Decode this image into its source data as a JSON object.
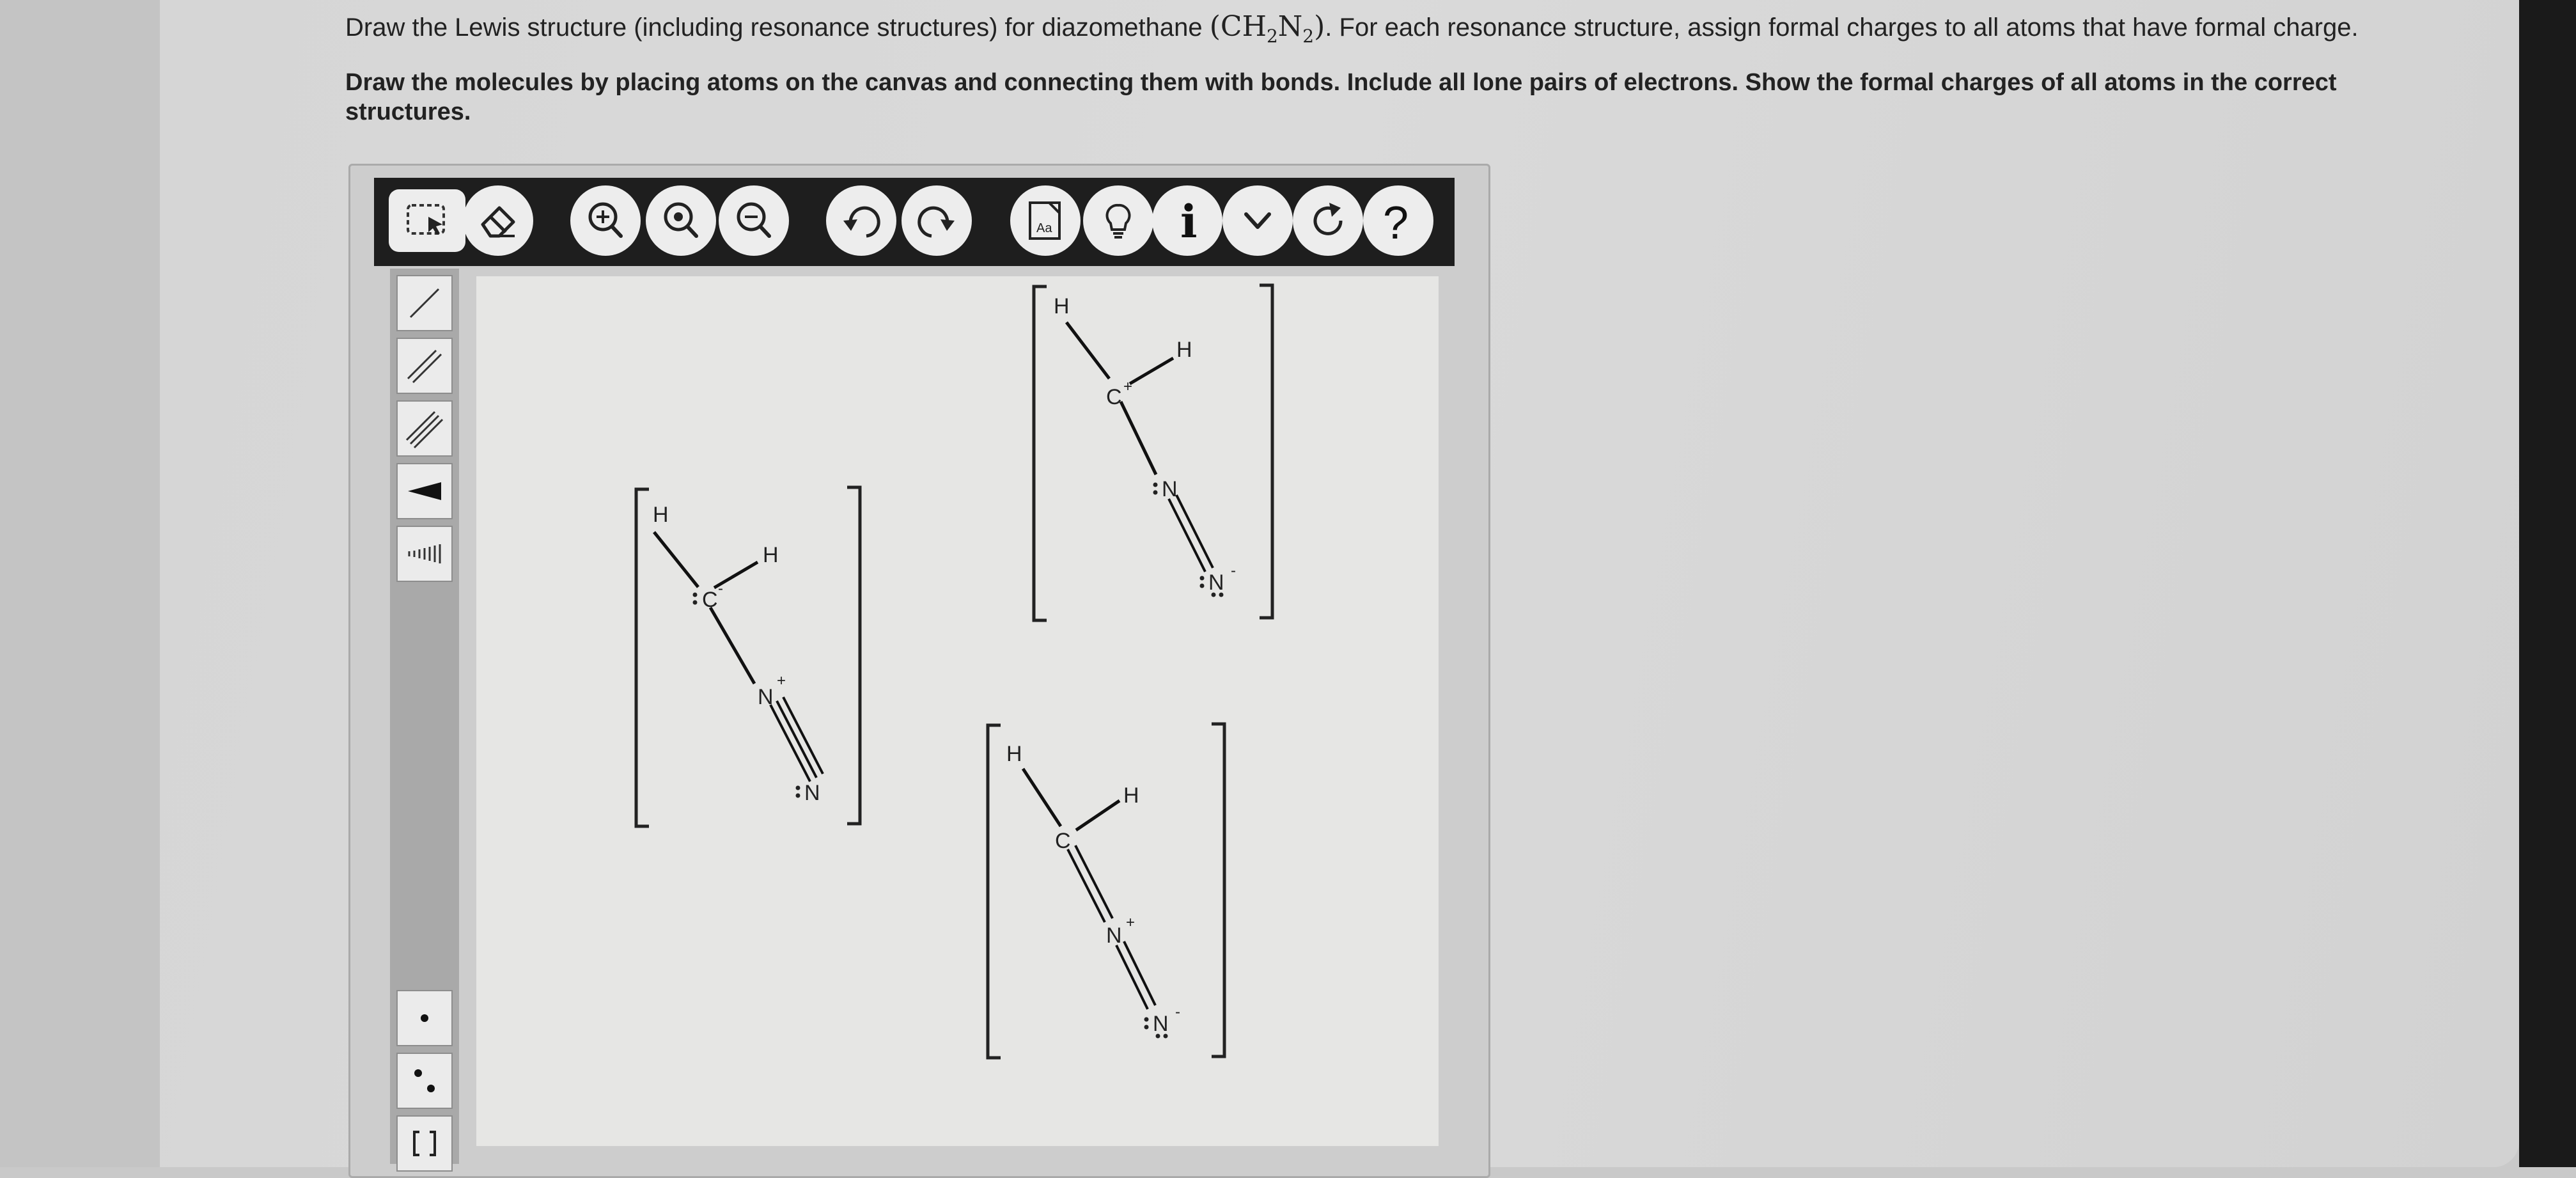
{
  "question": {
    "line1_pre": "Draw the Lewis structure (including resonance structures) for diazomethane",
    "formula_open": "(CH",
    "formula_sub1": "2",
    "formula_mid": "N",
    "formula_sub2": "2",
    "formula_close": ")",
    "line1_post": ". For each resonance structure, assign formal charges to all atoms that have formal charge.",
    "line2": "Draw the molecules by placing atoms on the canvas and connecting them with bonds. Include all lone pairs of electrons. Show the formal charges of all atoms in the correct structures."
  },
  "toolbar_top": [
    {
      "name": "select-lasso-button",
      "icon": "lasso-select-icon"
    },
    {
      "name": "eraser-button",
      "icon": "eraser-icon"
    },
    {
      "name": "zoom-in-button",
      "icon": "zoom-in-icon"
    },
    {
      "name": "zoom-reset-button",
      "icon": "zoom-reset-icon"
    },
    {
      "name": "zoom-out-button",
      "icon": "zoom-out-icon"
    },
    {
      "name": "undo-button",
      "icon": "undo-icon"
    },
    {
      "name": "redo-button",
      "icon": "redo-icon"
    },
    {
      "name": "templates-button",
      "icon": "template-icon",
      "label": "Aa"
    },
    {
      "name": "hint-button",
      "icon": "lightbulb-icon"
    },
    {
      "name": "info-button",
      "icon": "info-icon",
      "label": "i"
    },
    {
      "name": "more-button",
      "icon": "chevron-down-icon"
    },
    {
      "name": "reset-button",
      "icon": "reset-icon"
    },
    {
      "name": "help-button",
      "icon": "help-icon",
      "label": "?"
    }
  ],
  "toolbar_left": [
    {
      "name": "single-bond-tool",
      "icon": "single-bond-icon"
    },
    {
      "name": "double-bond-tool",
      "icon": "double-bond-icon"
    },
    {
      "name": "triple-bond-tool",
      "icon": "triple-bond-icon"
    },
    {
      "name": "wedge-bond-tool",
      "icon": "wedge-bond-icon"
    },
    {
      "name": "hash-bond-tool",
      "icon": "hash-bond-icon"
    },
    {
      "name": "radical-tool",
      "icon": "single-electron-icon"
    },
    {
      "name": "lone-pair-tool",
      "icon": "lone-pair-icon"
    },
    {
      "name": "bracket-tool",
      "icon": "bracket-icon"
    }
  ],
  "atoms": {
    "h": "H",
    "c": "C",
    "n": "N",
    "plus": "+",
    "minus": "-"
  }
}
